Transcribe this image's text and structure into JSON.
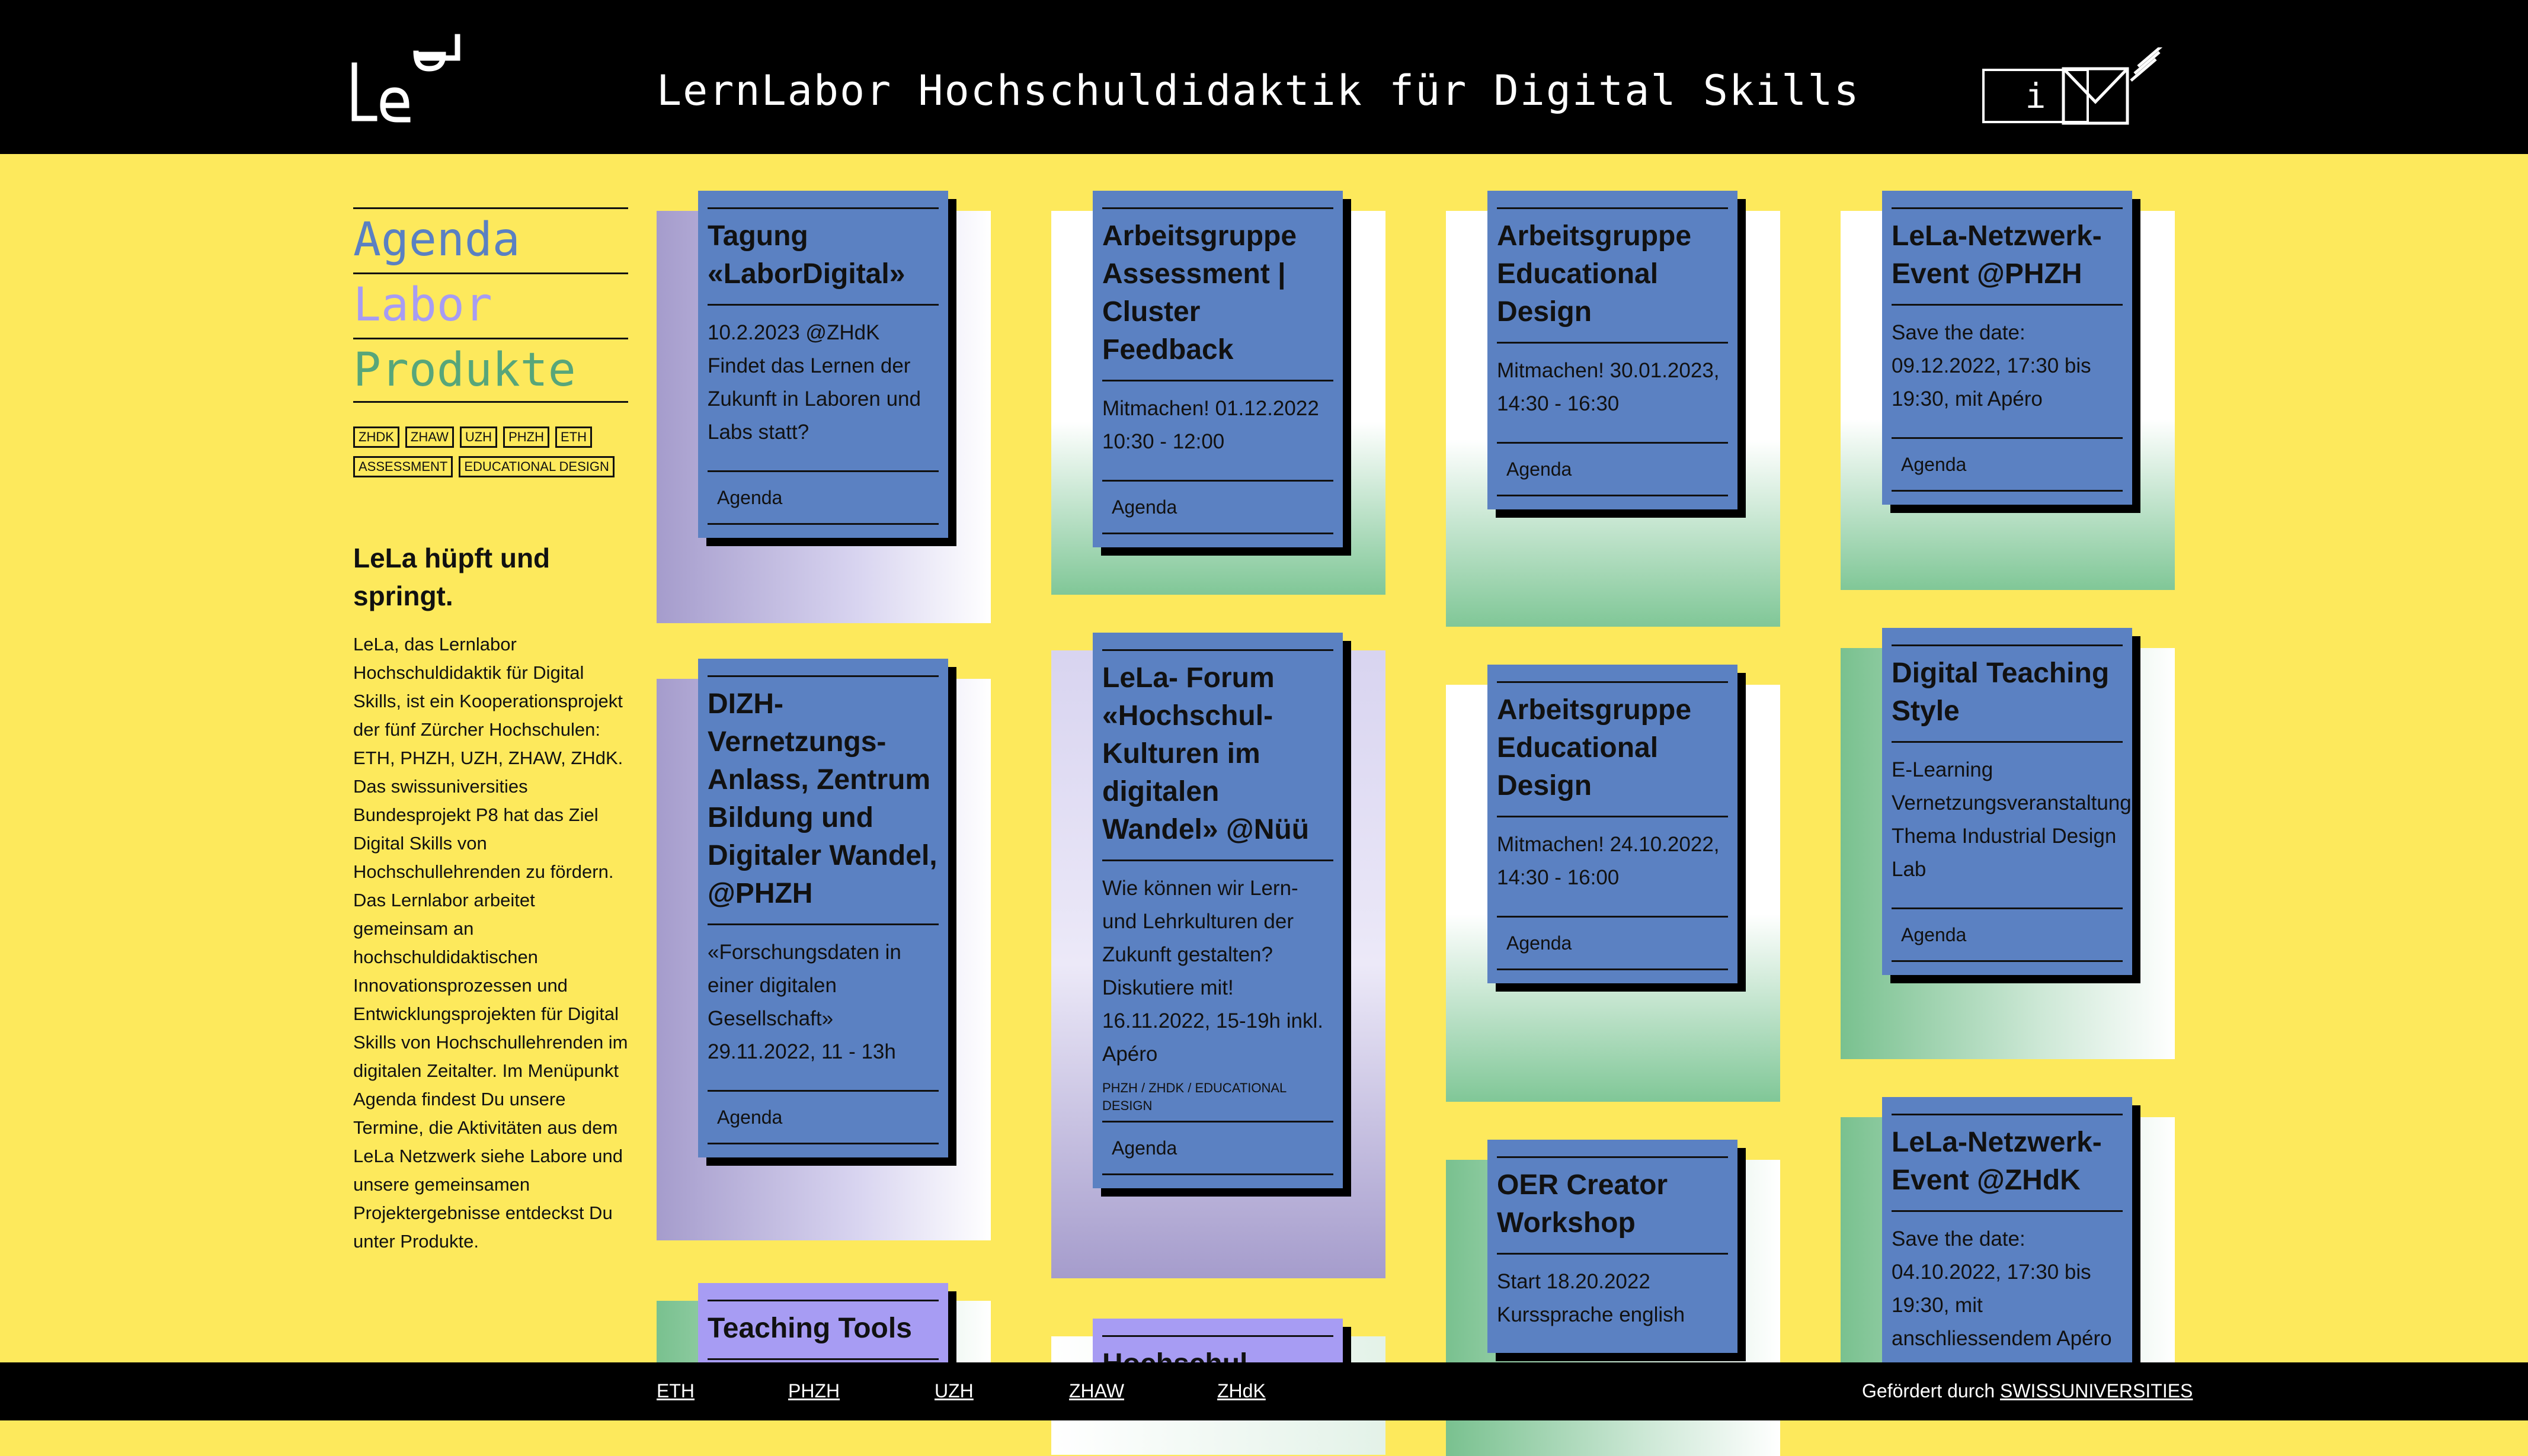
{
  "header": {
    "title": "LernLabor Hochschuldidaktik für Digital Skills",
    "info_label": "i"
  },
  "sidebar": {
    "nav": [
      {
        "label": "Agenda",
        "color": "#5a80c2"
      },
      {
        "label": "Labor",
        "color": "#a79cf3"
      },
      {
        "label": "Produkte",
        "color": "#57a67a"
      }
    ],
    "tags": [
      "ZHdK",
      "ZHAW",
      "UZH",
      "PHZH",
      "ETH",
      "ASSESSMENT",
      "EDUCATIONAL DESIGN"
    ],
    "intro_title": "LeLa hüpft und springt.",
    "intro_text": "LeLa, das Lernlabor Hochschuldidaktik für Digital Skills, ist ein Kooperationsprojekt der fünf Zürcher Hochschulen: ETH, PHZH, UZH, ZHAW, ZHdK. Das swissuniversities Bundesprojekt P8 hat das Ziel Digital Skills von Hochschullehrenden zu fördern. Das Lernlabor arbeitet gemeinsam an hochschuldidaktischen Innovationsprozessen und Entwicklungsprojekten für Digital Skills von Hochschullehrenden im digitalen Zeitalter. Im Menüpunkt Agenda findest Du unsere Termine, die Aktivitäten aus dem LeLa Netzwerk siehe Labore und unsere gemeinsamen Projektergebnisse entdeckst Du unter Produkte."
  },
  "cards": [
    {
      "title": "Tagung «LaborDigital»",
      "body": "10.2.2023 @ZHdK Findet das Lernen der Zukunft in Laboren und Labs statt?",
      "link": "Agenda",
      "tags": ""
    },
    {
      "title": "Arbeitsgruppe Assessment | Cluster Feedback",
      "body": "Mitmachen! 01.12.2022 10:30 - 12:00",
      "link": "Agenda",
      "tags": ""
    },
    {
      "title": "Arbeitsgruppe Educational Design",
      "body": "Mitmachen! 30.01.2023, 14:30 - 16:30",
      "link": "Agenda",
      "tags": ""
    },
    {
      "title": "LeLa-Netzwerk-Event @PHZH",
      "body": "Save the date: 09.12.2022, 17:30 bis 19:30, mit Apéro",
      "link": "Agenda",
      "tags": ""
    },
    {
      "title": "DIZH-Vernetzungs-Anlass, Zentrum Bildung und Digitaler Wandel, @PHZH",
      "body": "«Forschungsdaten in einer digitalen Gesellschaft» 29.11.2022, 11 - 13h",
      "link": "Agenda",
      "tags": ""
    },
    {
      "title": "LeLa- Forum «Hochschul-Kulturen im digitalen Wandel» @Nüü",
      "body": "Wie können wir Lern- und Lehrkulturen der Zukunft gestalten? Diskutiere mit! 16.11.2022, 15-19h inkl. Apéro",
      "link": "Agenda",
      "tags": "PHZH / ZHDK / EDUCATIONAL DESIGN"
    },
    {
      "title": "Arbeitsgruppe Educational Design",
      "body": "Mitmachen! 24.10.2022, 14:30 - 16:00",
      "link": "Agenda",
      "tags": ""
    },
    {
      "title": "Digital Teaching Style",
      "body": "E-Learning Vernetzungsveranstaltung Thema Industrial Design Lab",
      "link": "Agenda",
      "tags": ""
    },
    {
      "title": "OER Creator Workshop",
      "body": "Start 18.20.2022 Kurssprache english",
      "link": "",
      "tags": ""
    },
    {
      "title": "LeLa-Netzwerk-Event @ZHdK",
      "body": "Save the date: 04.10.2022, 17:30 bis 19:30, mit anschliessendem Apéro",
      "link": "",
      "tags": ""
    },
    {
      "title": "Teaching Tools",
      "body": "",
      "link": "",
      "tags": ""
    },
    {
      "title": "Hochschul…",
      "body": "",
      "link": "",
      "tags": ""
    }
  ],
  "footer": {
    "links": [
      "ETH",
      "PHZH",
      "UZH",
      "ZHAW",
      "ZHdK"
    ],
    "funding_prefix": "Gefördert durch",
    "funding_link": "SWISSUNIVERSITIES"
  }
}
